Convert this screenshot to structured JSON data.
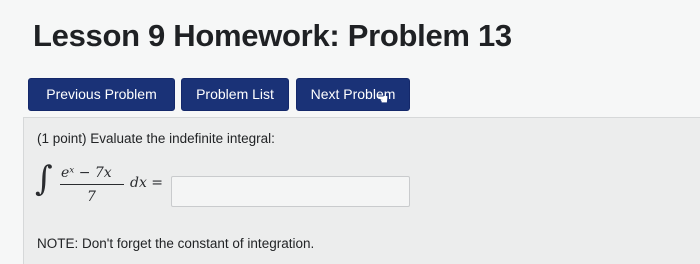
{
  "header": {
    "title": "Lesson 9 Homework: Problem 13"
  },
  "nav": {
    "previous_label": "Previous Problem",
    "list_label": "Problem List",
    "next_label": "Next Problem"
  },
  "problem": {
    "prompt": "(1 point) Evaluate the indefinite integral:",
    "math": {
      "integral_sign": "∫",
      "numerator": "eˣ − 7x",
      "denominator": "7",
      "differential": "dx ="
    },
    "answer_value": "",
    "note": "NOTE: Don't forget the constant of integration."
  },
  "colors": {
    "button_bg": "#1a3277",
    "page_bg": "#f6f7f7",
    "problem_bg": "#eceded"
  },
  "icons": {
    "cursor": "hand-pointer-icon"
  }
}
